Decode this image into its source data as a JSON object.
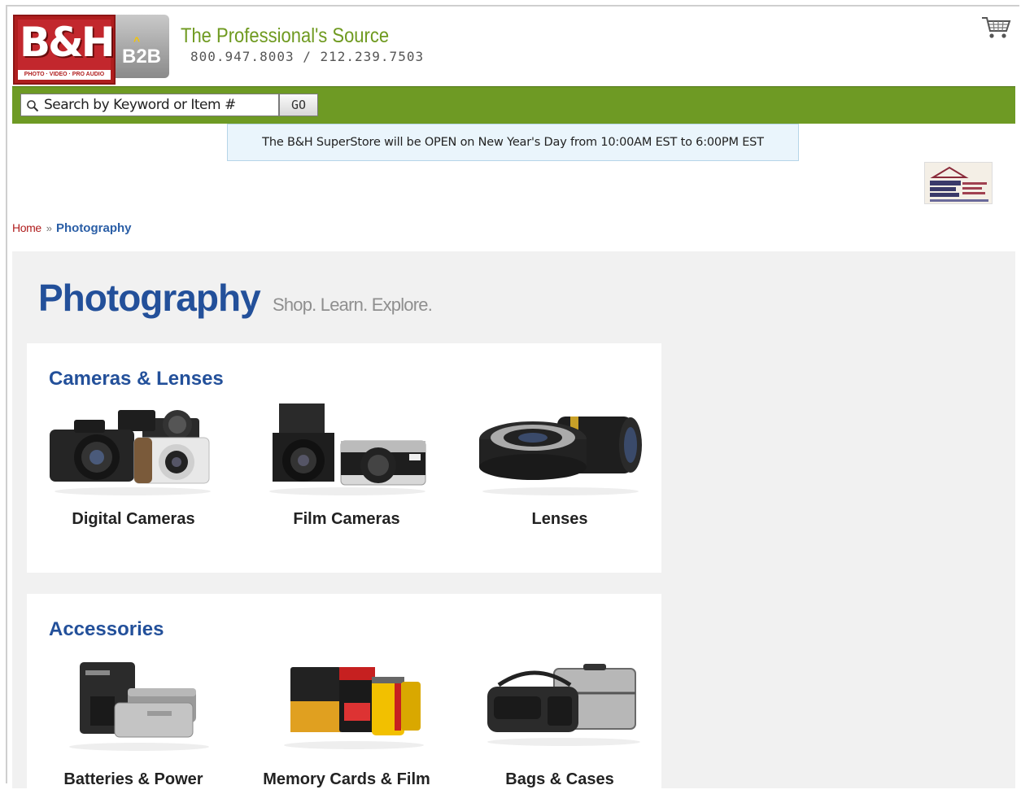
{
  "header": {
    "logo_letters": "B&H",
    "logo_tagline": "PHOTO · VIDEO · PRO AUDIO",
    "b2b_label": "B2B",
    "tagline": "The Professional's Source",
    "phone": "800.947.8003 / 212.239.7503"
  },
  "search": {
    "placeholder": "Search by Keyword or Item #",
    "go_label": "GO"
  },
  "notice": {
    "text": "The B&H SuperStore will be OPEN on New Year's Day from 10:00AM EST to 6:00PM EST"
  },
  "breadcrumb": {
    "home": "Home",
    "separator": "»",
    "current": "Photography"
  },
  "page": {
    "title": "Photography",
    "subtitle": "Shop. Learn. Explore."
  },
  "sections": [
    {
      "title": "Cameras & Lenses",
      "items": [
        {
          "label": "Digital Cameras",
          "icon": "digital-cameras-image"
        },
        {
          "label": "Film Cameras",
          "icon": "film-cameras-image"
        },
        {
          "label": "Lenses",
          "icon": "lenses-image"
        }
      ]
    },
    {
      "title": "Accessories",
      "items": [
        {
          "label": "Batteries & Power",
          "icon": "batteries-image"
        },
        {
          "label": "Memory Cards & Film",
          "icon": "memory-cards-image"
        },
        {
          "label": "Bags & Cases",
          "icon": "bags-cases-image"
        }
      ]
    }
  ],
  "colors": {
    "brand_red": "#b01e1e",
    "search_bar_green": "#6e9a24",
    "title_blue": "#23509a",
    "tagline_green": "#6f9a20"
  }
}
